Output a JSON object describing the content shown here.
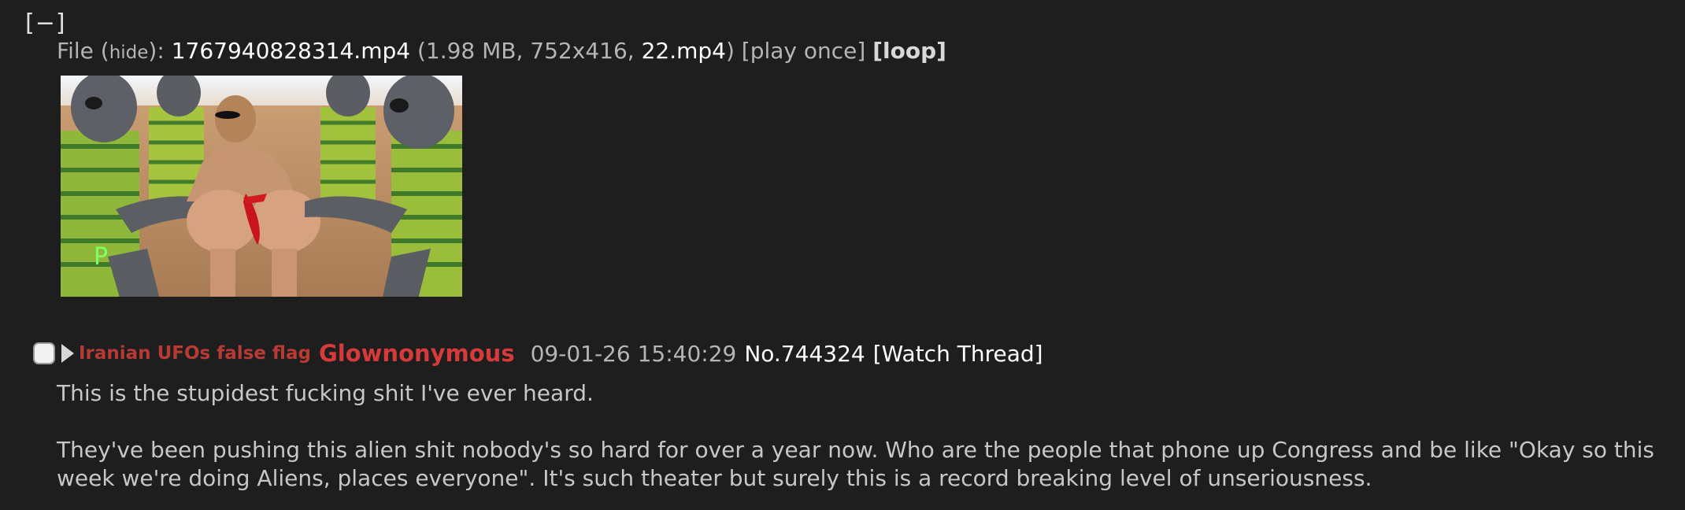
{
  "post": {
    "collapse_label": "[−]",
    "file": {
      "prefix": "File ",
      "hide_open": "(",
      "hide_label": "hide",
      "hide_close": ")",
      "colon": ": ",
      "filename": "1767940828314.mp4",
      "size_open": " (",
      "size_dims": "1.98 MB, 752x416, ",
      "original_name": "22.mp4",
      "size_close": ") ",
      "play_once": "[play once]",
      "loop": "[loop]"
    },
    "thumbnail": {
      "letter_mark": "P"
    },
    "subject": "Iranian UFOs false flag",
    "name": "Glownonymous",
    "datetime": "09-01-26 15:40:29",
    "post_number": "No.744324",
    "watch_thread": "[Watch Thread]",
    "body": [
      "This is the stupidest fucking shit I've ever heard.",
      "They've been pushing this alien shit nobody's so hard for over a year now. Who are the people that phone up Congress and be like \"Okay so this week we're doing Aliens, places everyone\". It's such theater but surely this is a record breaking level of unseriousness."
    ]
  },
  "colors": {
    "background": "#1e1e1e",
    "text": "#c5c8c6",
    "subject": "#b83a34",
    "name": "#d63a3a"
  }
}
